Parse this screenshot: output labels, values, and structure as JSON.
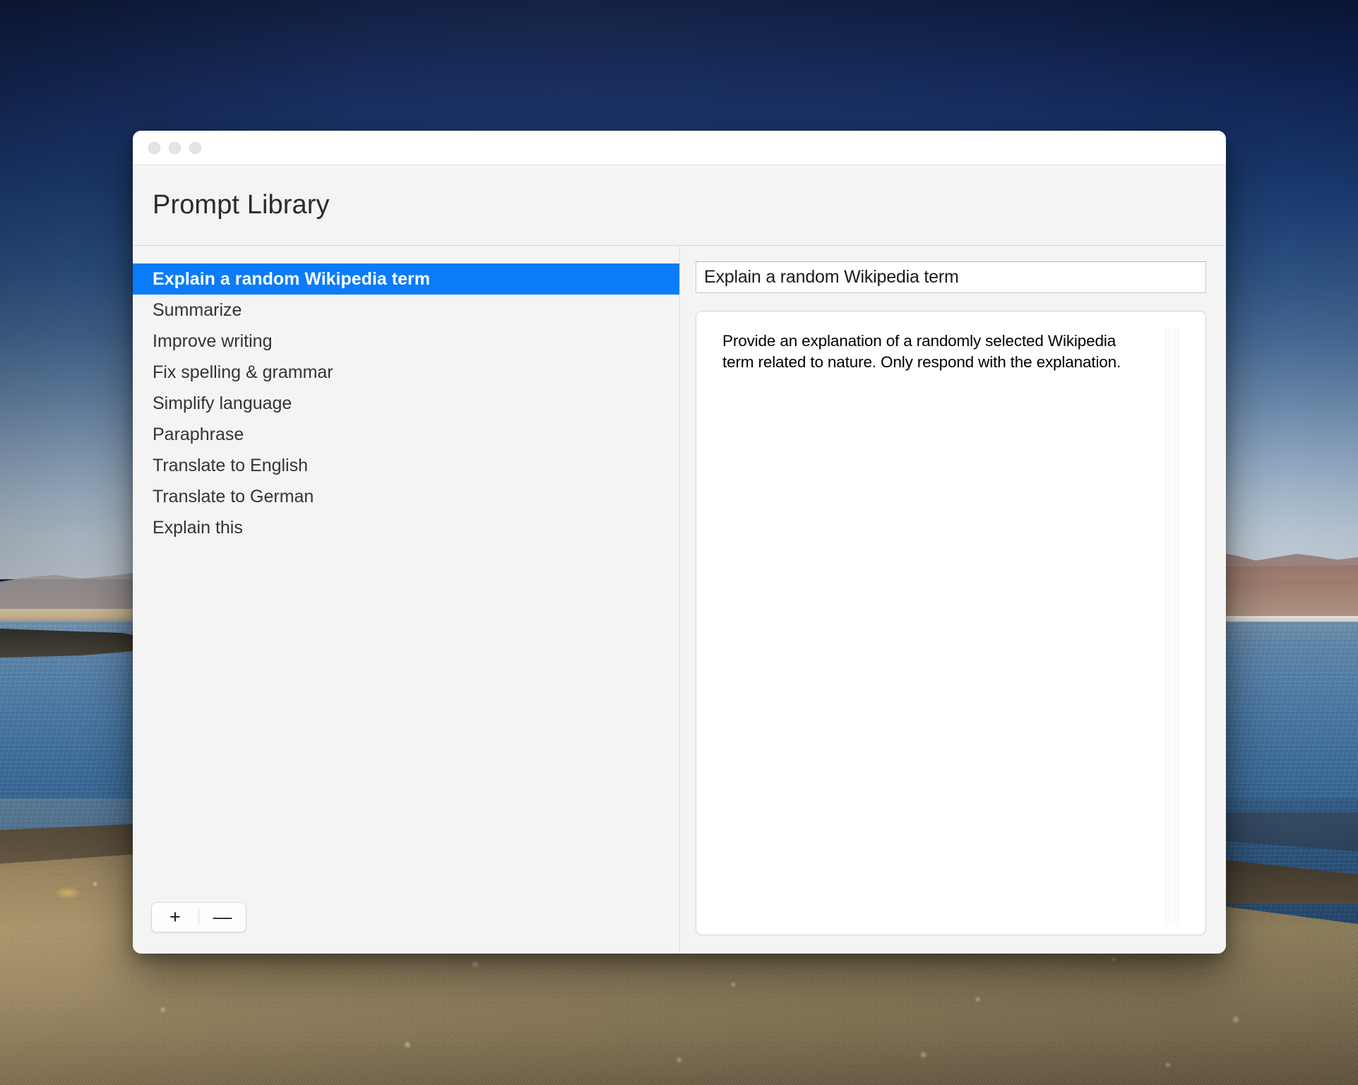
{
  "window": {
    "traffic_lights": [
      "close-button",
      "minimize-button",
      "zoom-button"
    ],
    "header_title": "Prompt Library"
  },
  "sidebar": {
    "items": [
      {
        "label": "Explain a random Wikipedia term",
        "selected": true
      },
      {
        "label": "Summarize",
        "selected": false
      },
      {
        "label": "Improve writing",
        "selected": false
      },
      {
        "label": "Fix spelling & grammar",
        "selected": false
      },
      {
        "label": "Simplify language",
        "selected": false
      },
      {
        "label": "Paraphrase",
        "selected": false
      },
      {
        "label": "Translate to English",
        "selected": false
      },
      {
        "label": "Translate to German",
        "selected": false
      },
      {
        "label": "Explain this",
        "selected": false
      }
    ],
    "toolbar": {
      "add_label": "+",
      "remove_label": "—"
    }
  },
  "detail": {
    "title_value": "Explain a random Wikipedia term",
    "title_placeholder": "Title",
    "body_value": "Provide an explanation of a randomly selected Wikipedia term related to nature. Only respond with the explanation.",
    "body_placeholder": "Prompt"
  },
  "colors": {
    "selection_blue": "#0a7cf7",
    "window_background": "#f4f4f4",
    "field_background": "#ffffff",
    "text_primary": "#2b2b2b"
  }
}
